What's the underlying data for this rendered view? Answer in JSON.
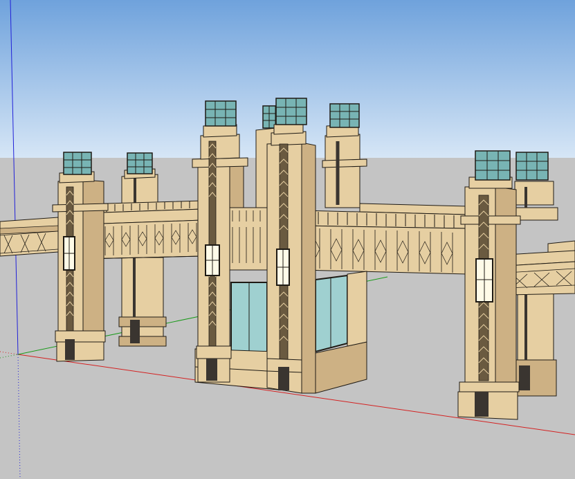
{
  "viewport": {
    "sky_top_color": "#6fa2dc",
    "sky_horizon_color": "#d6e6f6",
    "ground_color": "#c4c4c4"
  },
  "axes": {
    "x_axis_color": "#d42020",
    "y_axis_color": "#1a9a1a",
    "z_axis_color": "#2020d8"
  },
  "model": {
    "type": "gateway-entrance",
    "stone_color": "#e6cfa2",
    "stone_shadow_color": "#cdb184",
    "outline_color": "#1e1a14",
    "glass_cube_color": "#78b4b4",
    "glass_window_color": "#9fd0d0",
    "lamp_color": "#fffbe8",
    "vent_color": "#3a3530"
  }
}
